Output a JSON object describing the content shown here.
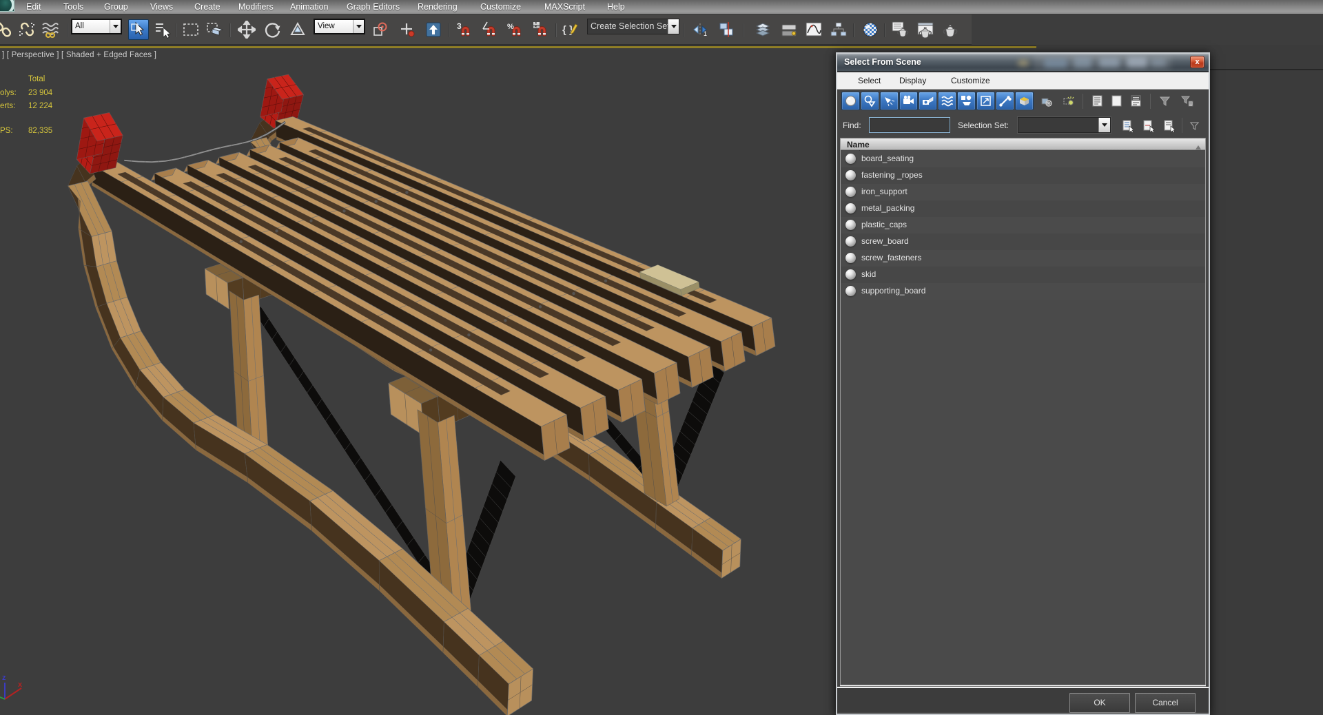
{
  "app": {
    "menu": [
      "Edit",
      "Tools",
      "Group",
      "Views",
      "Create",
      "Modifiers",
      "Animation",
      "Graph Editors",
      "Rendering",
      "Customize",
      "MAXScript",
      "Help"
    ]
  },
  "toolbar": {
    "selection_filter_value": "All",
    "coord_system_value": "View",
    "named_sets_value": "Create Selection Set",
    "snap_3d_label": "3",
    "snap_percent_label": "%"
  },
  "viewport": {
    "label": "] [ Perspective ] [ Shaded + Edged Faces ]",
    "stats": {
      "header": "Total",
      "rows": [
        {
          "label": "olys:",
          "value": "23 904"
        },
        {
          "label": "erts:",
          "value": "12 224"
        },
        {
          "label": "PS:",
          "value": "82,335"
        }
      ]
    },
    "axis": {
      "x_label": "x",
      "z_label": "z"
    }
  },
  "dialog": {
    "title": "Select From Scene",
    "menu": [
      "Select",
      "Display",
      "Customize"
    ],
    "find_label": "Find:",
    "find_value": "",
    "selection_set_label": "Selection Set:",
    "selection_set_value": "",
    "column_header": "Name",
    "rows": [
      "board_seating",
      "fastening _ropes",
      "iron_support",
      "metal_packing",
      "plastic_caps",
      "screw_board",
      "screw_fasteners",
      "skid",
      "supporting_board"
    ],
    "ok_label": "OK",
    "close_label": "x",
    "cancel_label": "Cancel"
  },
  "colors": {
    "viewport_bg": "#3d3d3d",
    "toolbar_bg": "#474645",
    "active_viewport_border": "#9c8a2d",
    "dialog_toggle_blue": "#3a76c4",
    "close_button_red": "#c64029",
    "stats_yellow": "#d6c63d",
    "wood": "#bd9460",
    "cap_red": "#b51c15"
  }
}
